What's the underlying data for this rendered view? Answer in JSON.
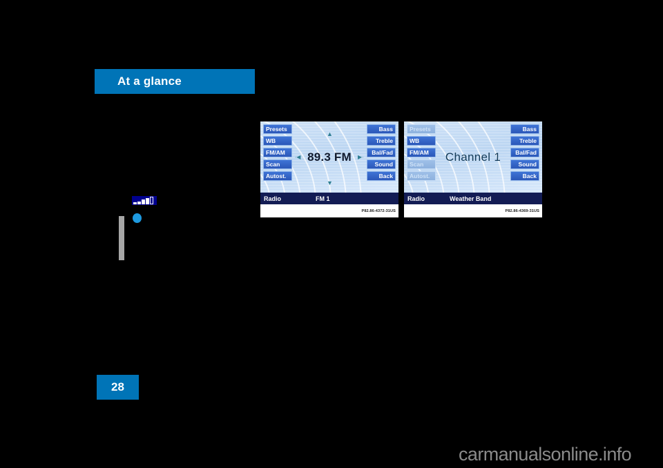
{
  "page": {
    "header_title": "At a glance",
    "page_number": "28",
    "watermark": "carmanualsonline.info",
    "accent_color": "#0074b7",
    "background_color": "#000000"
  },
  "marks": {
    "signal_icon_name": "signal-bars-icon",
    "bullet_dot_name": "blue-bullet-dot",
    "rule_name": "gray-vertical-rule"
  },
  "figures": [
    {
      "id": "radio-fm-display",
      "caption": "P82.86-4372-31US",
      "center_text": "89.3 FM",
      "center_style": "frequency",
      "status": {
        "left": "Radio",
        "middle": "FM 1"
      },
      "left_buttons": [
        {
          "label": "Presets",
          "dim": false
        },
        {
          "label": "WB",
          "dim": false
        },
        {
          "label": "FM/AM",
          "dim": false
        },
        {
          "label": "Scan",
          "dim": false
        },
        {
          "label": "Autost.",
          "dim": false
        }
      ],
      "right_buttons": [
        {
          "label": "Bass",
          "dim": false
        },
        {
          "label": "Treble",
          "dim": false
        },
        {
          "label": "Bal/Fad",
          "dim": false
        },
        {
          "label": "Sound",
          "dim": false
        },
        {
          "label": "Back",
          "dim": false
        }
      ],
      "arrows": {
        "up": "▲",
        "down": "▼",
        "left": "∙◀",
        "right": "▶∙"
      },
      "show_arrows": true
    },
    {
      "id": "radio-weather-band-display",
      "caption": "P82.86-4369-31US",
      "center_text": "Channel 1",
      "center_style": "channel",
      "status": {
        "left": "Radio",
        "middle": "Weather Band"
      },
      "left_buttons": [
        {
          "label": "Presets",
          "dim": true
        },
        {
          "label": "WB",
          "dim": false
        },
        {
          "label": "FM/AM",
          "dim": false
        },
        {
          "label": "Scan",
          "dim": true
        },
        {
          "label": "Autost.",
          "dim": true
        }
      ],
      "right_buttons": [
        {
          "label": "Bass",
          "dim": false
        },
        {
          "label": "Treble",
          "dim": false
        },
        {
          "label": "Bal/Fad",
          "dim": false
        },
        {
          "label": "Sound",
          "dim": false
        },
        {
          "label": "Back",
          "dim": false
        }
      ],
      "arrows": {
        "up": "",
        "down": "",
        "left": "",
        "right": ""
      },
      "show_arrows": false
    }
  ]
}
